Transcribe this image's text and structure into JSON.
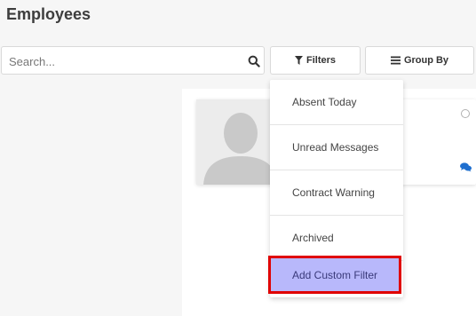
{
  "page": {
    "title": "Employees"
  },
  "search": {
    "placeholder": "Search...",
    "value": ""
  },
  "toolbar": {
    "filters_label": "Filters",
    "groupby_label": "Group By"
  },
  "filters_menu": {
    "items": [
      {
        "label": "Absent Today"
      },
      {
        "label": "Unread Messages"
      },
      {
        "label": "Contract Warning"
      },
      {
        "label": "Archived"
      },
      {
        "label": "Add Custom Filter",
        "highlighted": true
      }
    ]
  },
  "icons": {
    "search": "search-icon",
    "filter": "filter-icon",
    "group_by": "list-icon",
    "status": "status-circle-icon",
    "chat": "chat-icon"
  },
  "colors": {
    "highlight_fill": "#b8b8fb",
    "highlight_border": "#e00000",
    "chat_icon": "#1f6fcf"
  }
}
